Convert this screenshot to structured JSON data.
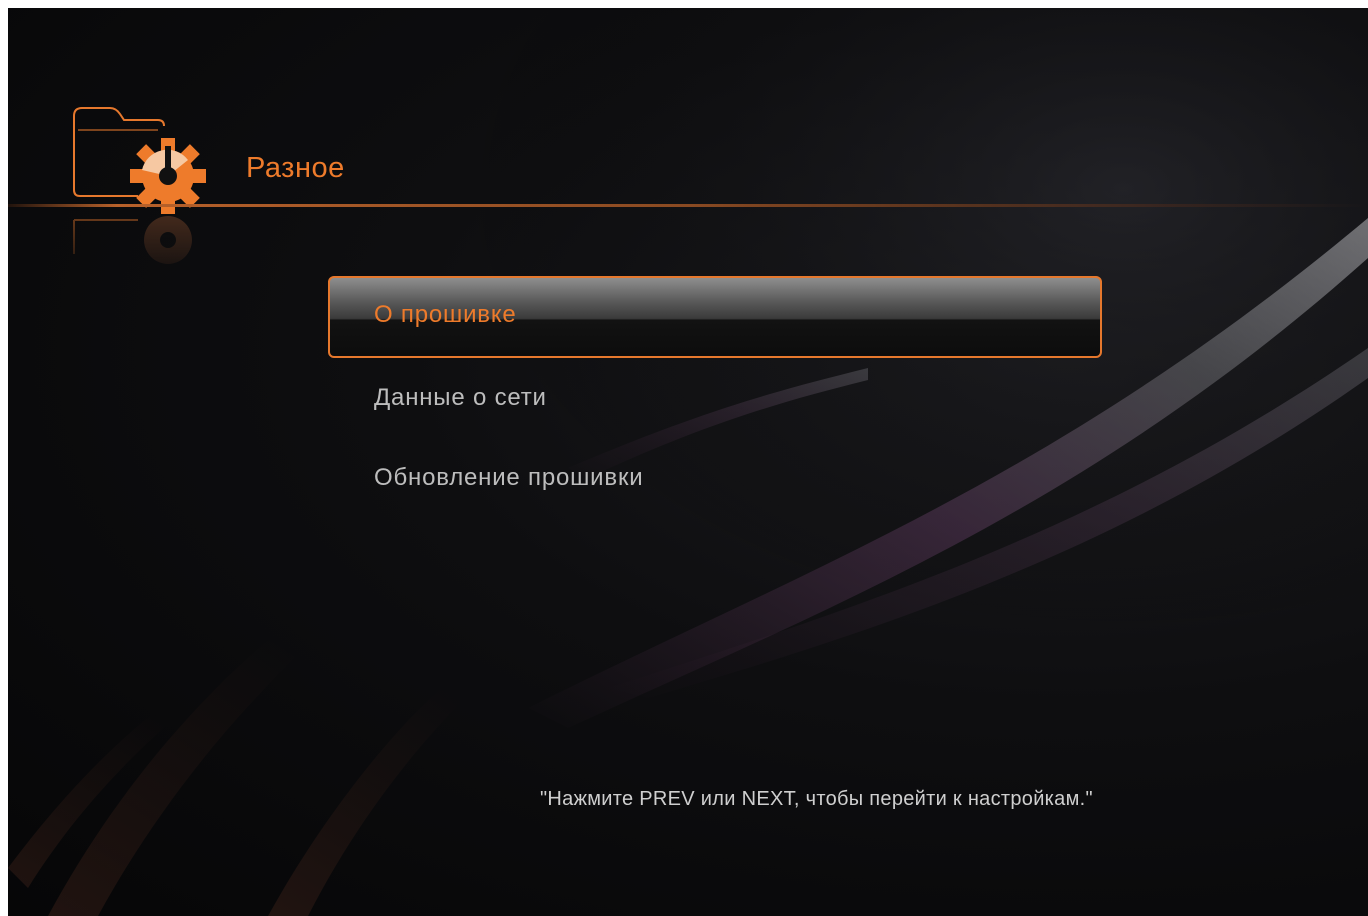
{
  "header": {
    "title": "Разное",
    "icon": "folder-gear-icon"
  },
  "menu": {
    "items": [
      {
        "label": "О прошивке",
        "selected": true
      },
      {
        "label": "Данные о сети",
        "selected": false
      },
      {
        "label": "Обновление прошивки",
        "selected": false
      }
    ]
  },
  "hint": "\"Нажмите PREV или NEXT, чтобы перейти к настройкам.\"",
  "colors": {
    "accent": "#ee7b2b",
    "background": "#0b0b0c",
    "text": "#bdbdbd"
  }
}
